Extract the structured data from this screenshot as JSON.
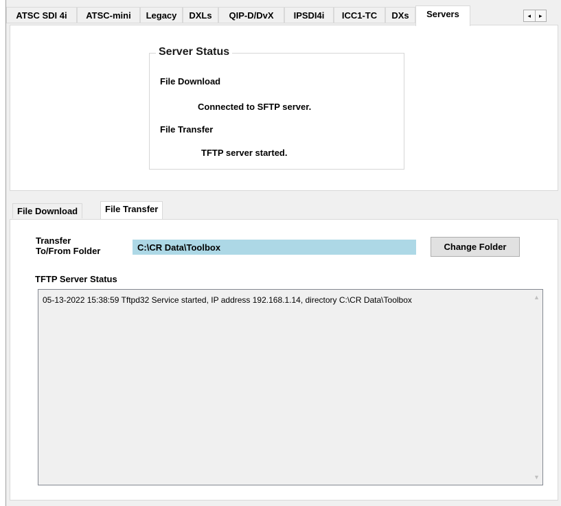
{
  "top_tabs": [
    {
      "label": "ATSC SDI 4i"
    },
    {
      "label": "ATSC-mini"
    },
    {
      "label": "Legacy"
    },
    {
      "label": "DXLs"
    },
    {
      "label": "QIP-D/DvX"
    },
    {
      "label": "IPSDI4i"
    },
    {
      "label": "ICC1-TC"
    },
    {
      "label": "DXs"
    },
    {
      "label": "Servers"
    }
  ],
  "active_top_tab": "Servers",
  "tab_scroll": {
    "left": "◂",
    "right": "▸"
  },
  "server_status": {
    "title": "Server Status",
    "file_download_label": "File Download",
    "file_download_status": "Connected to SFTP server.",
    "file_transfer_label": "File Transfer",
    "file_transfer_status": "TFTP server started."
  },
  "sub_tabs": [
    {
      "label": "File Download"
    },
    {
      "label": "File Transfer"
    }
  ],
  "active_sub_tab": "File Transfer",
  "file_transfer": {
    "folder_label_line1": "Transfer",
    "folder_label_line2": "To/From Folder",
    "folder_value": "C:\\CR Data\\Toolbox",
    "change_folder_label": "Change Folder",
    "tftp_status_label": "TFTP Server Status",
    "log_lines": [
      "05-13-2022 15:38:59  Tftpd32 Service started, IP address 192.168.1.14, directory C:\\CR Data\\Toolbox"
    ]
  },
  "colors": {
    "folder_input_bg": "#add8e6",
    "panel_bg": "#ffffff",
    "window_bg": "#f0f0f0"
  }
}
